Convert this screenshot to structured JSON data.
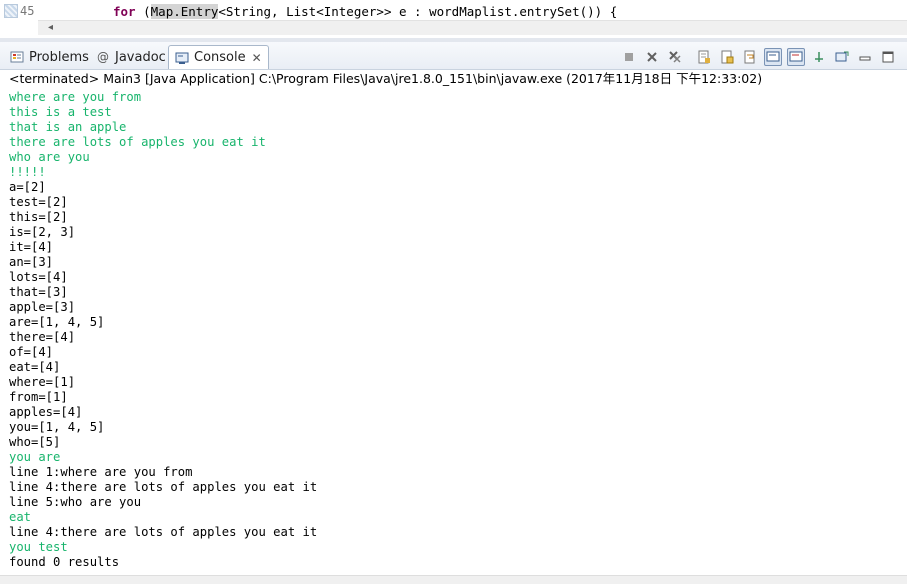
{
  "editor": {
    "line_number": "45",
    "code_keyword": "for",
    "code_open": " (",
    "code_highlight": "Map.Entry",
    "code_rest": "<String, List<Integer>> e : wordMaplist.entrySet()) {",
    "scroll_arrow": "◂"
  },
  "tabs": [
    {
      "label": "Problems",
      "icon": "problems-icon"
    },
    {
      "label": "Javadoc",
      "icon": "javadoc-at-icon"
    },
    {
      "label": "Console",
      "icon": "console-icon"
    }
  ],
  "console_header": "<terminated> Main3 [Java Application] C:\\Program Files\\Java\\jre1.8.0_151\\bin\\javaw.exe (2017年11月18日 下午12:33:02)",
  "console_lines": [
    {
      "text": "where are you from",
      "kind": "in"
    },
    {
      "text": "this is a test",
      "kind": "in"
    },
    {
      "text": "that is an apple",
      "kind": "in"
    },
    {
      "text": "there are lots of apples you eat it",
      "kind": "in"
    },
    {
      "text": "who are you",
      "kind": "in"
    },
    {
      "text": "!!!!!",
      "kind": "in"
    },
    {
      "text": "a=[2]",
      "kind": "out"
    },
    {
      "text": "test=[2]",
      "kind": "out"
    },
    {
      "text": "this=[2]",
      "kind": "out"
    },
    {
      "text": "is=[2, 3]",
      "kind": "out"
    },
    {
      "text": "it=[4]",
      "kind": "out"
    },
    {
      "text": "an=[3]",
      "kind": "out"
    },
    {
      "text": "lots=[4]",
      "kind": "out"
    },
    {
      "text": "that=[3]",
      "kind": "out"
    },
    {
      "text": "apple=[3]",
      "kind": "out"
    },
    {
      "text": "are=[1, 4, 5]",
      "kind": "out"
    },
    {
      "text": "there=[4]",
      "kind": "out"
    },
    {
      "text": "of=[4]",
      "kind": "out"
    },
    {
      "text": "eat=[4]",
      "kind": "out"
    },
    {
      "text": "where=[1]",
      "kind": "out"
    },
    {
      "text": "from=[1]",
      "kind": "out"
    },
    {
      "text": "apples=[4]",
      "kind": "out"
    },
    {
      "text": "you=[1, 4, 5]",
      "kind": "out"
    },
    {
      "text": "who=[5]",
      "kind": "out"
    },
    {
      "text": "you are",
      "kind": "in"
    },
    {
      "text": "line 1:where are you from",
      "kind": "out"
    },
    {
      "text": "line 4:there are lots of apples you eat it",
      "kind": "out"
    },
    {
      "text": "line 5:who are you",
      "kind": "out"
    },
    {
      "text": "eat",
      "kind": "in"
    },
    {
      "text": "line 4:there are lots of apples you eat it",
      "kind": "out"
    },
    {
      "text": "you test",
      "kind": "in"
    },
    {
      "text": "found 0 results",
      "kind": "out"
    }
  ],
  "colors": {
    "input_text": "#18b46c",
    "output_text": "#000000",
    "keyword": "#7f0055"
  },
  "toolbar_icons": [
    "terminate-icon",
    "remove-launch-icon",
    "remove-all-terminated-icon",
    "clear-console-icon",
    "scroll-lock-icon",
    "word-wrap-icon",
    "show-on-stdout-icon",
    "show-on-stderr-icon",
    "pin-console-icon",
    "open-console-icon",
    "minimize-icon",
    "maximize-icon"
  ]
}
